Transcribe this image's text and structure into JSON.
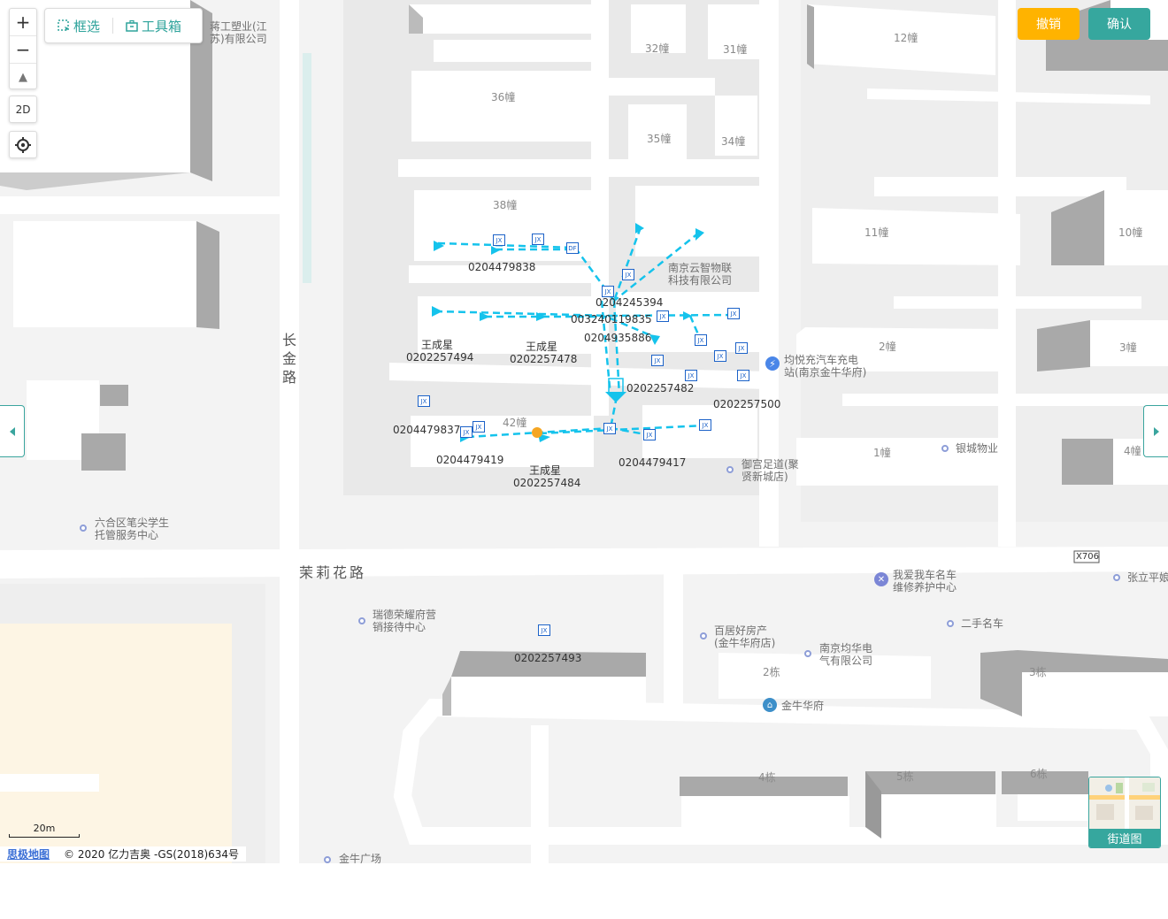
{
  "toolbar": {
    "box_select_label": "框选",
    "toolbox_label": "工具箱"
  },
  "controls": {
    "zoom_in": "+",
    "zoom_out": "−",
    "view_2d": "2D"
  },
  "buttons": {
    "undo_label": "撤销",
    "confirm_label": "确认",
    "undo_color": "#ffb300",
    "confirm_color": "#36a79e"
  },
  "street_view": {
    "label": "街道图"
  },
  "scale": {
    "label": "20m"
  },
  "attribution": {
    "brand": "思极地图",
    "text": "© 2020 亿力吉奥 -GS(2018)634号"
  },
  "roads": {
    "molihua": "茉莉花路",
    "changjin": "长金路",
    "x706": "X706"
  },
  "buildings": {
    "b32": "32幢",
    "b31": "31幢",
    "b36": "36幢",
    "b35": "35幢",
    "b34": "34幢",
    "b38": "38幢",
    "b12": "12幢",
    "b11": "11幢",
    "b10": "10幢",
    "b2": "2幢",
    "b3": "3幢",
    "b1": "1幢",
    "b4": "4幢",
    "b42": "42幢",
    "s2": "2栋",
    "s3": "3栋",
    "s4": "4栋",
    "s5": "5栋",
    "s6": "6栋"
  },
  "pois": {
    "jiangong_l1": "蒋工塑业(江",
    "jiangong_l2": "苏)有限公司",
    "yunzhi_l1": "南京云智物联",
    "yunzhi_l2": "科技有限公司",
    "junyue_l1": "均悦充汽车充电",
    "junyue_l2": "站(南京金牛华府)",
    "yincheng": "银城物业",
    "yugong_l1": "御宫足道(聚",
    "yugong_l2": "贤新城店)",
    "liuhe_l1": "六合区笔尖学生",
    "liuhe_l2": "托管服务中心",
    "woai_l1": "我爱我车名车",
    "woai_l2": "维修养护中心",
    "zhangli": "张立平娘",
    "ruide_l1": "瑞德荣耀府营",
    "ruide_l2": "销接待中心",
    "baiju_l1": "百居好房产",
    "baiju_l2": "(金牛华府店)",
    "junhua_l1": "南京均华电",
    "junhua_l2": "气有限公司",
    "ershou": "二手名车",
    "jinniu": "金牛华府",
    "jinniu_square": "金牛广场"
  },
  "network_labels": {
    "n1": "0204479838",
    "n2": "0204245394",
    "n3": "003240119835",
    "n4": "0204935886",
    "n5_name": "王成星",
    "n5": "0202257494",
    "n6_name": "王成星",
    "n6": "0202257478",
    "n7": "0202257482",
    "n8": "0202257500",
    "n9": "0204479837",
    "n10": "0204479419",
    "n11": "0204479417",
    "n12_name": "王成星",
    "n12": "0202257484",
    "n13": "0202257493"
  },
  "device_tags": {
    "jx": "JX",
    "df": "DF"
  },
  "colors": {
    "network_line": "#15c3ec",
    "device_box": "#1c62c8",
    "map_bg": "#f3f3f3",
    "building_top": "#ffffff",
    "building_side": "#a9a9a9",
    "sand_area": "#fdf5e4"
  }
}
